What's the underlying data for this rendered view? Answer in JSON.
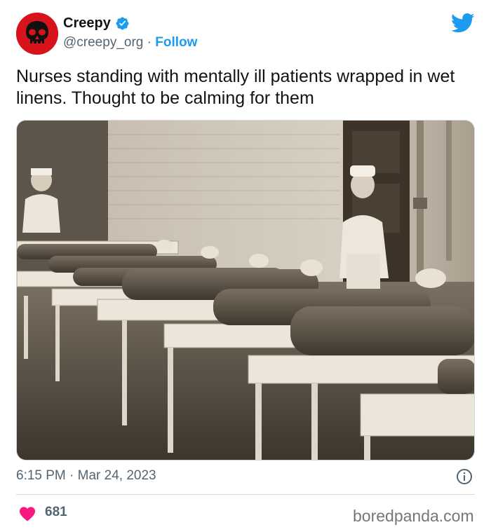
{
  "author": {
    "display_name": "Creepy",
    "handle": "@creepy_org",
    "separator": "·",
    "follow_label": "Follow"
  },
  "tweet": {
    "text": "Nurses standing with mentally ill patients wrapped in wet linens. Thought to be calming for them",
    "time": "6:15 PM",
    "date_separator": "·",
    "date": "Mar 24, 2023"
  },
  "engagement": {
    "likes": "681"
  },
  "watermark": "boredpanda.com",
  "colors": {
    "accent": "#1d9bf0",
    "avatar_red": "#d7141c",
    "heart": "#f91880",
    "secondary_text": "#536471"
  },
  "icons": {
    "verified": "verified-badge-icon",
    "twitter": "twitter-bird-icon",
    "info": "info-icon",
    "like": "heart-icon",
    "avatar_art": "skull-icon"
  }
}
